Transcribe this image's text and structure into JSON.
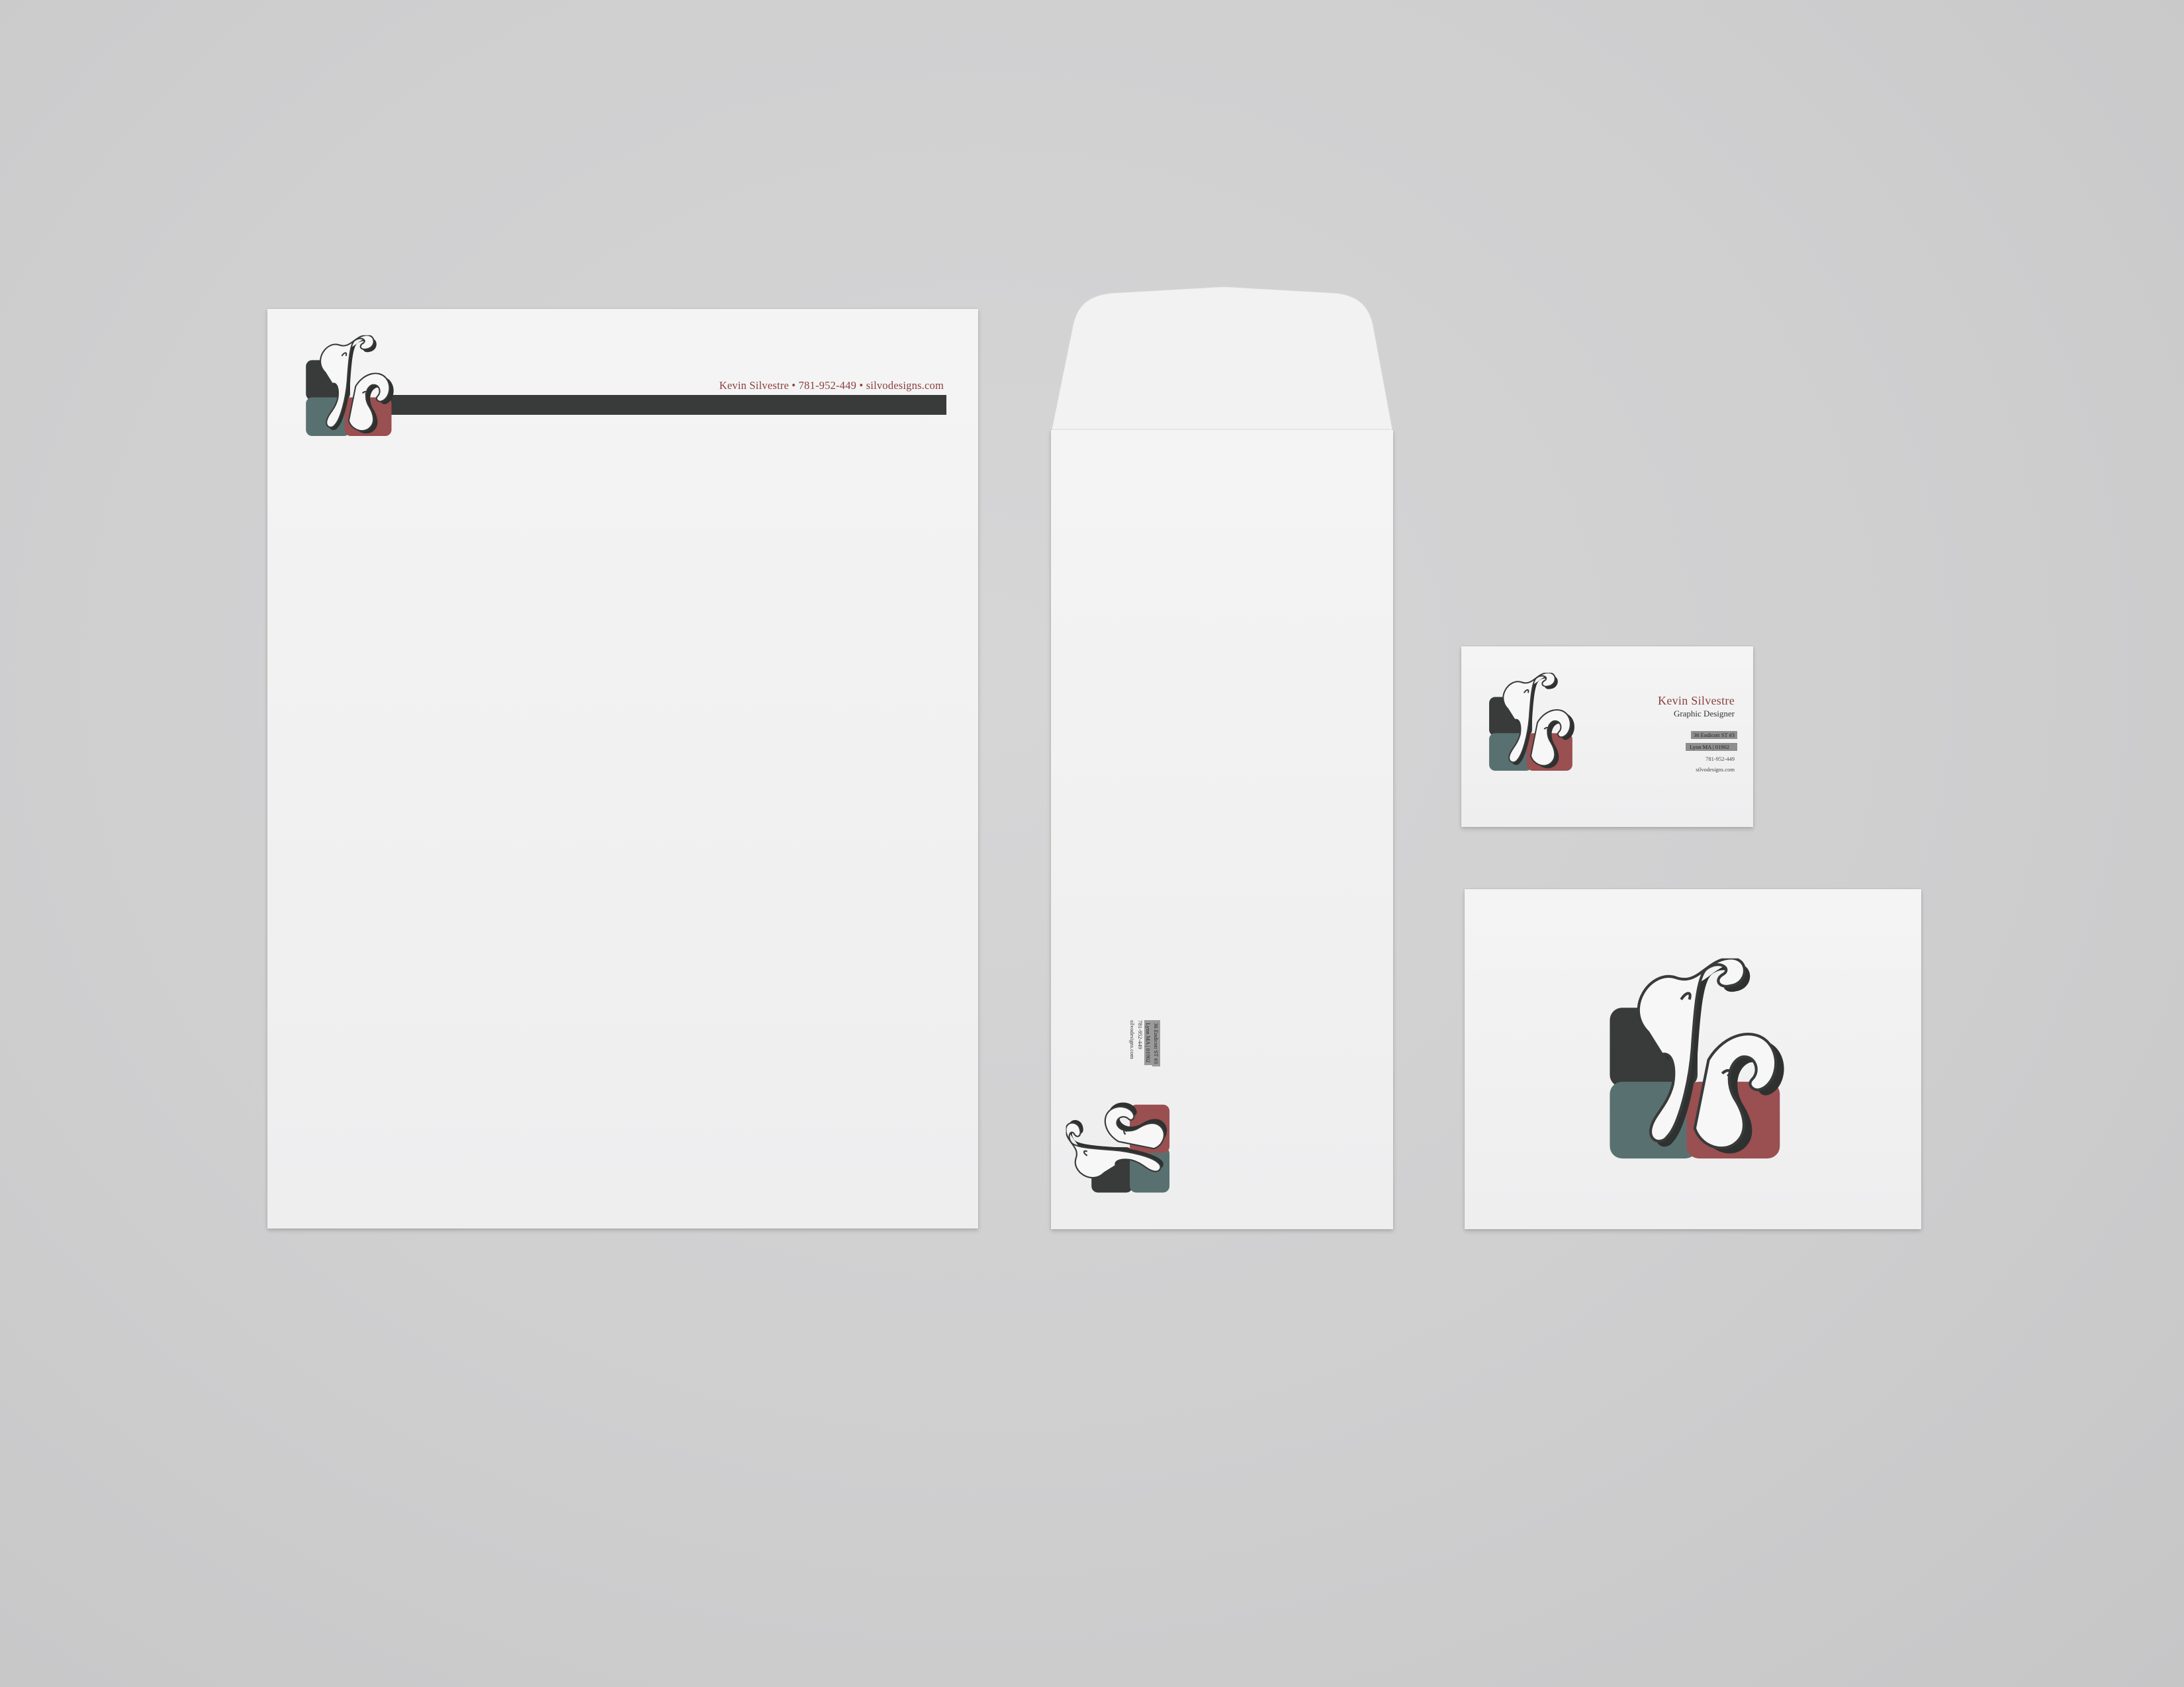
{
  "scene": "stationery-mockup",
  "brand": {
    "colors": {
      "dark": "#383b39",
      "teal": "#587170",
      "maroon": "#9a4f51",
      "accent_text": "#8c3e3e"
    },
    "logo_icon": "ks-monogram-logo"
  },
  "letterhead": {
    "contact_line": "Kevin Silvestre • 781-952-449 • silvodesigns.com"
  },
  "envelope": {
    "address_line1": "36 Endicott ST #3",
    "address_line2": "Lynn MA | 01902",
    "phone": "781-952-449",
    "website": "silvodesigns.com"
  },
  "business_card": {
    "name": "Kevin Silvestre",
    "title": "Graphic Designer",
    "address_line1": "36 Endicott ST #3",
    "address_line2": "Lynn MA | 01902",
    "phone": "781-952-449",
    "website": "silvodesigns.com"
  },
  "note_card": {}
}
